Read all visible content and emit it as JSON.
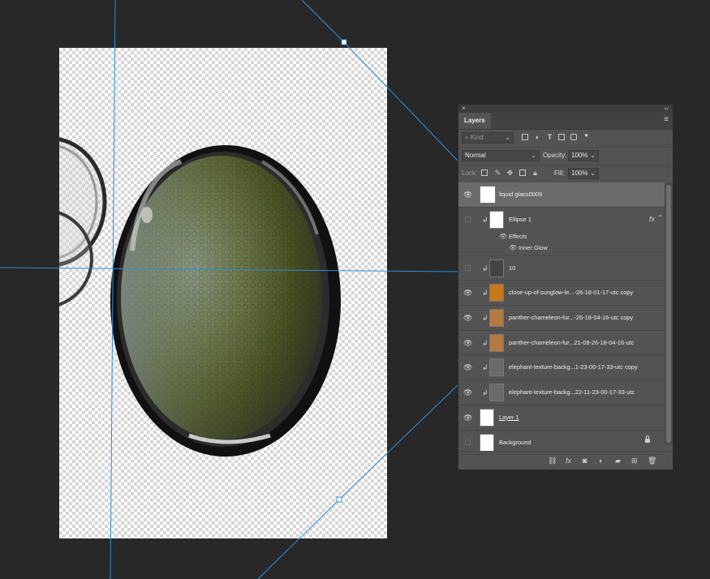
{
  "panel": {
    "close_glyph": "×",
    "collapse_glyph": "‹‹",
    "tab_label": "Layers",
    "menu_glyph": "≡"
  },
  "filter": {
    "placeholder": "Kind",
    "icons": [
      "image-filter-icon",
      "adjustment-filter-icon",
      "type-filter-icon",
      "shape-filter-icon",
      "smart-object-filter-icon",
      "filter-toggle-icon"
    ]
  },
  "blend": {
    "mode": "Normal",
    "opacity_label": "Opacity:",
    "opacity_value": "100%"
  },
  "lock": {
    "label": "Lock:",
    "fill_label": "Fill:",
    "fill_value": "100%"
  },
  "layers": [
    {
      "name": "liquid glass0009",
      "visible": true,
      "selected": true,
      "clipped": false,
      "underline": false,
      "thumb_color": "#ffffff"
    },
    {
      "name": "Ellipse 1",
      "visible": false,
      "selected": false,
      "clipped": true,
      "underline": false,
      "thumb_color": "#ffffff",
      "has_fx": true
    },
    {
      "name": "10",
      "visible": false,
      "selected": false,
      "clipped": true,
      "underline": false,
      "thumb_color": "#444444"
    },
    {
      "name": "close-up-of-sunglow-le...-26-18-01-17-utc copy",
      "visible": true,
      "selected": false,
      "clipped": true,
      "underline": false,
      "thumb_color": "#c8781c"
    },
    {
      "name": "panther-chameleon-fur...-26-18-04-16-utc copy",
      "visible": true,
      "selected": false,
      "clipped": true,
      "underline": false,
      "thumb_color": "#b47a44"
    },
    {
      "name": "panther-chameleon-fur...21-08-26-18-04-16-utc",
      "visible": true,
      "selected": false,
      "clipped": true,
      "underline": false,
      "thumb_color": "#b47a44"
    },
    {
      "name": "elephant-texture-backg...1-23-00-17-33-utc copy",
      "visible": true,
      "selected": false,
      "clipped": true,
      "underline": false,
      "thumb_color": "#6a6a6a"
    },
    {
      "name": "elephant-texture-backg...22-11-23-00-17-33-utc",
      "visible": true,
      "selected": false,
      "clipped": true,
      "underline": false,
      "thumb_color": "#6a6a6a"
    },
    {
      "name": "Layer 1",
      "visible": true,
      "selected": false,
      "clipped": false,
      "underline": true,
      "thumb_color": "#b9c28a"
    },
    {
      "name": "Background",
      "visible": false,
      "selected": false,
      "clipped": false,
      "underline": false,
      "thumb_color": "#d4dcaa",
      "locked": true
    }
  ],
  "effects": {
    "header": "Effects",
    "inner_glow": "Inner Glow"
  },
  "colors": {
    "guide": "#2f8fd8",
    "workspace": "#282828",
    "panel_bg": "#535353",
    "selected_row": "#6a6a6a"
  }
}
